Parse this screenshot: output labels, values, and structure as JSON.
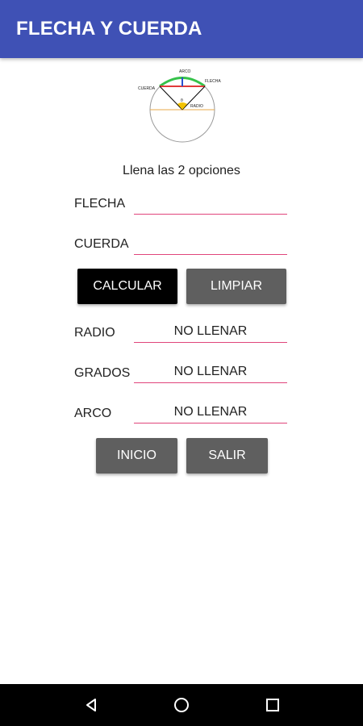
{
  "app_bar": {
    "title": "FLECHA Y CUERDA",
    "color": "#3f51b5"
  },
  "diagram": {
    "labels": {
      "arco": "ARCO",
      "flecha": "FLECHA",
      "cuerda": "CUERDA",
      "radio": "RADIO",
      "angle": "θ"
    }
  },
  "instruction": "Llena las 2 opciones",
  "inputs": {
    "flecha": {
      "label": "FLECHA",
      "value": ""
    },
    "cuerda": {
      "label": "CUERDA",
      "value": ""
    }
  },
  "buttons": {
    "calcular": "CALCULAR",
    "limpiar": "LIMPIAR",
    "inicio": "INICIO",
    "salir": "SALIR"
  },
  "outputs": {
    "radio": {
      "label": "RADIO",
      "value": "NO LLENAR"
    },
    "grados": {
      "label": "GRADOS",
      "value": "NO LLENAR"
    },
    "arco": {
      "label": "ARCO",
      "value": "NO LLENAR"
    }
  },
  "nav": {
    "icons": [
      "back-icon",
      "home-icon",
      "recents-icon"
    ]
  },
  "colors": {
    "underline": "#e0457b",
    "button_primary": "#000000",
    "button_secondary": "#5f5f5f"
  }
}
